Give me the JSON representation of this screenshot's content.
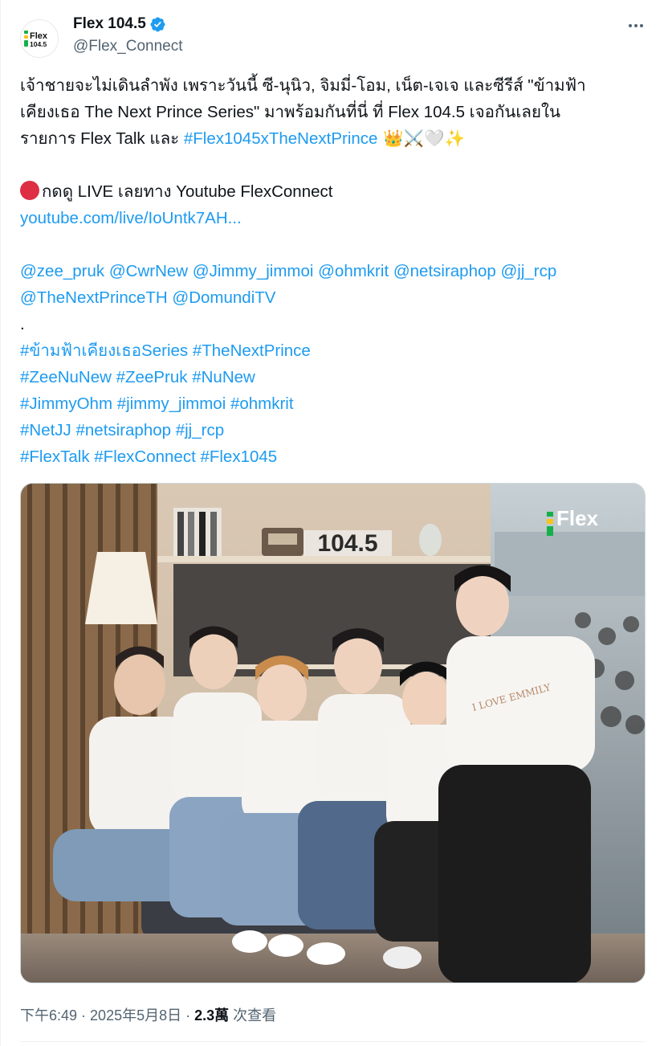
{
  "author": {
    "display_name": "Flex 104.5",
    "handle": "@Flex_Connect",
    "logo_text_top": "Flex",
    "logo_text_bottom": "104.5",
    "verified": true,
    "icons": {
      "verified": "verified-badge-icon",
      "more": "more-options-icon"
    }
  },
  "tweet": {
    "line1": "เจ้าชายจะไม่เดินลำพัง เพราะวันนี้ ซี-นุนิว, จิมมี่-โอม, เน็ต-เจเจ และซีรีส์ \"ข้ามฟ้า",
    "line2": "เคียงเธอ The Next Prince Series\" มาพร้อมกันที่นี่ ที่ Flex 104.5 เจอกันเลยใน",
    "line3_text": "รายการ Flex Talk และ ",
    "line3_hashtag": "#Flex1045xTheNextPrince",
    "line3_emojis": " 👑⚔️🤍✨",
    "live_text": "กดดู LIVE เลยทาง Youtube FlexConnect",
    "live_link": "youtube.com/live/IoUntk7AH...",
    "mentions_line1": "@zee_pruk @CwrNew @Jimmy_jimmoi @ohmkrit @netsiraphop @jj_rcp",
    "mentions_line2": "@TheNextPrinceTH @DomundiTV",
    "dot": ".",
    "hashtags": [
      "#ข้ามฟ้าเคียงเธอSeries #TheNextPrince",
      "#ZeeNuNew #ZeePruk #NuNew",
      "#JimmyOhm #jimmy_jimmoi #ohmkrit",
      "#NetJJ #netsiraphop #jj_rcp",
      "#FlexTalk #FlexConnect #Flex1045"
    ]
  },
  "media": {
    "sign_text": "104.5",
    "watermark": "Flex",
    "shirt_text": "I LOVE EMMILY"
  },
  "meta": {
    "time": "下午6:49",
    "sep1": " · ",
    "date": "2025年5月8日",
    "sep2": " · ",
    "views": "2.3萬",
    "views_label": " 次查看"
  },
  "colors": {
    "link": "#1d9bf0",
    "text": "#0f1419",
    "secondary": "#536471",
    "live_dot": "#dd2e44"
  }
}
